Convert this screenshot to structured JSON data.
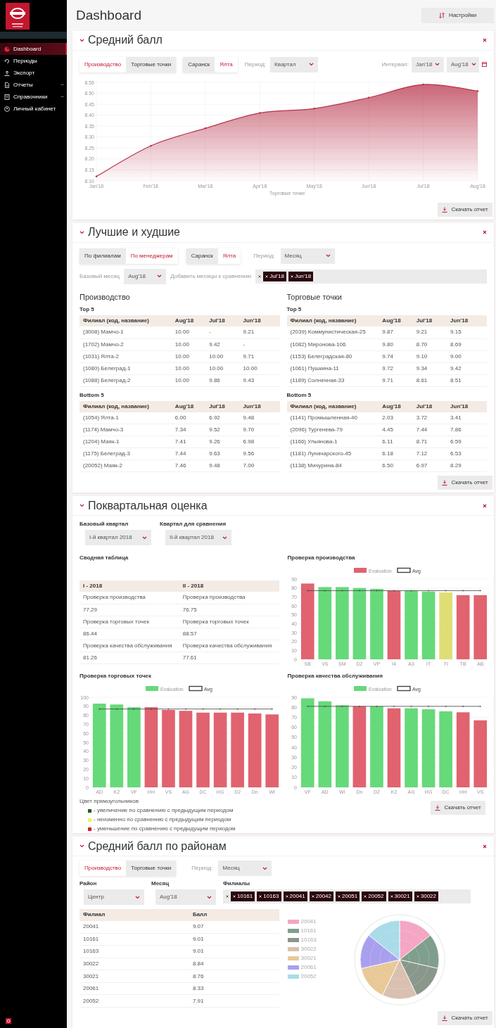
{
  "sidebar": {
    "items": [
      {
        "label": "Dashboard",
        "selected": true,
        "has_submenu": false
      },
      {
        "label": "Периоды",
        "selected": false,
        "has_submenu": false
      },
      {
        "label": "Экспорт",
        "selected": false,
        "has_submenu": false
      },
      {
        "label": "Отчеты",
        "selected": false,
        "has_submenu": true
      },
      {
        "label": "Справочники",
        "selected": false,
        "has_submenu": true
      },
      {
        "label": "Личный кабинет",
        "selected": false,
        "has_submenu": false
      }
    ]
  },
  "page_title": "Dashboard",
  "settings_button": "Настройки",
  "average_score": {
    "title": "Средний балл",
    "toggles": [
      [
        {
          "label": "Производство",
          "selected": true
        },
        {
          "label": "Торговые точки",
          "selected": false
        }
      ],
      [
        {
          "label": "Саранск",
          "selected": false
        },
        {
          "label": "Ялта",
          "selected": true
        }
      ]
    ],
    "period": {
      "label": "Период:",
      "value": "Квартал"
    },
    "interval": {
      "label": "Интервал:",
      "from": "Jan'18",
      "to": "Aug'18"
    },
    "chart_data": {
      "type": "area",
      "xlabel": "Торговые точки",
      "categories": [
        "Jan'18",
        "Feb'18",
        "Mar'18",
        "Apr'18",
        "May'18",
        "Jun'18",
        "Jul'18",
        "Aug'18"
      ],
      "series": [
        {
          "color": "#b8334a",
          "values": [
            8.12,
            8.26,
            8.34,
            8.41,
            8.43,
            8.48,
            8.54,
            8.51
          ]
        }
      ],
      "ylim": [
        8.1,
        8.55
      ],
      "grid": true,
      "yticks": [
        {
          "value": 8.1,
          "label": "8.10"
        },
        {
          "value": 8.15,
          "label": "8.15"
        },
        {
          "value": 8.2,
          "label": "8.20"
        },
        {
          "value": 8.25,
          "label": "8.25"
        },
        {
          "value": 8.3,
          "label": "8.30"
        },
        {
          "value": 8.35,
          "label": "8.35"
        },
        {
          "value": 8.4,
          "label": "8.40"
        },
        {
          "value": 8.45,
          "label": "8.45"
        },
        {
          "value": 8.5,
          "label": "8.50"
        },
        {
          "value": 8.55,
          "label": "8.55"
        }
      ]
    },
    "download_button": "Скачать отчет"
  },
  "best_worst": {
    "title": "Лучшие и худшие",
    "toggles": [
      [
        {
          "label": "По филиалам",
          "selected": false
        },
        {
          "label": "По менеджерам",
          "selected": true
        }
      ],
      [
        {
          "label": "Саранск",
          "selected": false
        },
        {
          "label": "Ялта",
          "selected": true
        }
      ]
    ],
    "period": {
      "label": "Период:",
      "value": "Месяц"
    },
    "base_month": {
      "label": "Базовый месяц",
      "value": "Aug'18"
    },
    "compare": {
      "label": "Добавить месяцы к сравнению",
      "tags": [
        "Jul'18",
        "Jun'18"
      ]
    },
    "groups": [
      {
        "title": "Производство",
        "tables": [
          {
            "title": "Top 5",
            "columns": [
              "Филиал (код, название)",
              "Aug'18",
              "Jul'18",
              "Jun'18"
            ],
            "rows": [
              [
                "(3008) Мамчо-1",
                "10.00",
                "-",
                "9.21"
              ],
              [
                "(1702) Мамчо-2",
                "10.00",
                "9.42",
                "-"
              ],
              [
                "(1031) Ялта-2",
                "10.00",
                "10.00",
                "9.71"
              ],
              [
                "(1080) Белеград-1",
                "10.00",
                "10.00",
                "10.00"
              ],
              [
                "(1088) Белеград-2",
                "10.00",
                "9.86",
                "9.43"
              ]
            ]
          },
          {
            "title": "Bottom 5",
            "columns": [
              "Филиал (код, название)",
              "Aug'18",
              "Jul'18",
              "Jun'18"
            ],
            "rows": [
              [
                "(1054) Ялта-1",
                "6.00",
                "6.92",
                "9.48"
              ],
              [
                "(1174) Мамчо-3",
                "7.34",
                "9.52",
                "9.70"
              ],
              [
                "(1204) Маяк-1",
                "7.41",
                "9.26",
                "6.98"
              ],
              [
                "(1175) Белеград-3",
                "7.44",
                "9.63",
                "9.56"
              ],
              [
                "(20052) Маяк-2",
                "7.46",
                "9.48",
                "7.00"
              ]
            ]
          }
        ]
      },
      {
        "title": "Торговые точки",
        "tables": [
          {
            "title": "Top 5",
            "columns": [
              "Филиал (код, название)",
              "Aug'18",
              "Jul'18",
              "Jun'18"
            ],
            "rows": [
              [
                "(2039) Коммунистическая-25",
                "9.87",
                "9.21",
                "9.15"
              ],
              [
                "(1082) Миронова-106",
                "9.80",
                "8.70",
                "8.69"
              ],
              [
                "(1153) Белеградская-80",
                "9.74",
                "9.10",
                "9.00"
              ],
              [
                "(1061) Пушкина-11",
                "9.72",
                "9.34",
                "9.42"
              ],
              [
                "(1189) Солнечная-33",
                "9.71",
                "8.61",
                "8.51"
              ]
            ]
          },
          {
            "title": "Bottom 5",
            "columns": [
              "Филиал (код, название)",
              "Aug'18",
              "Jul'18",
              "Jun'18"
            ],
            "rows": [
              [
                "(1141) Промышленная-40",
                "2.03",
                "3.72",
                "3.41"
              ],
              [
                "(2096) Тургенева-79",
                "4.45",
                "7.44",
                "7.86"
              ],
              [
                "(1166) Ульянова-1",
                "6.11",
                "8.71",
                "6.59"
              ],
              [
                "(1181) Луначарского-45",
                "6.18",
                "7.12",
                "6.53"
              ],
              [
                "(1138) Мичурина-84",
                "6.50",
                "6.97",
                "8.29"
              ]
            ]
          }
        ]
      }
    ],
    "download_button": "Скачать отчет"
  },
  "quarterly": {
    "title": "Поквартальная оценка",
    "base_quarter": {
      "label": "Базовый квартал",
      "value": "I-й квартал 2018"
    },
    "compare_quarter": {
      "label": "Квартал для сравнения",
      "value": "II-й квартал 2018"
    },
    "summary": {
      "title": "Сводная таблица",
      "columns": [
        "I - 2018",
        "II - 2018"
      ],
      "rows": [
        [
          "Проверка производства",
          "Проверка производства"
        ],
        [
          "77.29",
          "76.75"
        ],
        [
          "Проверка торговых точек",
          "Проверка торговых точек"
        ],
        [
          "86.44",
          "88.57"
        ],
        [
          "Проверка качества обслуживания",
          "Проверка качества обслуживания"
        ],
        [
          "81.26",
          "77.61"
        ]
      ]
    },
    "charts": [
      {
        "title": "Проверка производства",
        "chart_data": {
          "type": "bar",
          "categories": [
            "SB",
            "VS",
            "SM",
            "D2",
            "VP",
            "I4",
            "A3",
            "IT",
            "TI",
            "TB",
            "AB"
          ],
          "series": [
            {
              "name": "Evaluation",
              "type": "bar",
              "values": [
                85,
                81,
                81,
                80,
                79,
                77,
                77,
                76,
                75,
                72,
                72
              ],
              "colors": [
                "#e0636f",
                "#66d97a",
                "#66d97a",
                "#66d97a",
                "#66d97a",
                "#e0636f",
                "#66d97a",
                "#66d97a",
                "#dede74",
                "#e0636f",
                "#e0636f"
              ]
            },
            {
              "name": "Avg",
              "type": "line",
              "color": "#444444",
              "values": [
                77,
                77,
                77,
                77,
                77,
                77,
                77,
                77,
                77,
                77,
                77
              ]
            }
          ],
          "grid": true,
          "legend": "top",
          "ylim": [
            0,
            90
          ],
          "yticks": [
            0,
            10,
            20,
            30,
            40,
            50,
            60,
            70,
            80,
            90
          ]
        }
      },
      {
        "title": "Проверка торговых точек",
        "chart_data": {
          "type": "bar",
          "categories": [
            "AD",
            "K2",
            "VF",
            "HH",
            "VS",
            "AG",
            "DC",
            "HG",
            "D2",
            "Dn",
            "WI"
          ],
          "series": [
            {
              "name": "Evaluation",
              "type": "bar",
              "values": [
                93,
                92,
                89,
                89,
                86,
                85,
                83,
                83,
                83,
                82,
                81
              ],
              "colors": [
                "#66d97a",
                "#66d97a",
                "#66d97a",
                "#e0636f",
                "#e0636f",
                "#e0636f",
                "#e0636f",
                "#e0636f",
                "#e0636f",
                "#e0636f",
                "#e0636f"
              ]
            },
            {
              "name": "Avg",
              "type": "line",
              "color": "#444444",
              "values": [
                87,
                87,
                87,
                87,
                87,
                87,
                87,
                87,
                87,
                87,
                87
              ]
            }
          ],
          "grid": true,
          "legend": "top",
          "ylim": [
            0,
            100
          ],
          "yticks": [
            0,
            10,
            20,
            30,
            40,
            50,
            60,
            70,
            80,
            90,
            100
          ]
        }
      },
      {
        "title": "Проверка качества обслуживания",
        "chart_data": {
          "type": "bar",
          "categories": [
            "VF",
            "AD",
            "WI",
            "Dn",
            "D2",
            "K2",
            "AG",
            "HG",
            "DC",
            "HH",
            "VS"
          ],
          "series": [
            {
              "name": "Evaluation",
              "type": "bar",
              "values": [
                89,
                86,
                82,
                81,
                81,
                79,
                79,
                78,
                76,
                75,
                67
              ],
              "colors": [
                "#66d97a",
                "#66d97a",
                "#66d97a",
                "#e0636f",
                "#66d97a",
                "#e0636f",
                "#66d97a",
                "#66d97a",
                "#66d97a",
                "#e0636f",
                "#e0636f"
              ]
            },
            {
              "name": "Avg",
              "type": "line",
              "color": "#444444",
              "values": [
                81,
                81,
                81,
                81,
                81,
                81,
                81,
                81,
                81,
                81,
                81
              ]
            }
          ],
          "grid": true,
          "legend": "top",
          "ylim": [
            0,
            90
          ],
          "yticks": [
            0,
            10,
            20,
            30,
            40,
            50,
            60,
            70,
            80,
            90
          ]
        }
      }
    ],
    "color_legend": {
      "title": "Цвет прямоугольников",
      "items": [
        {
          "label": "- увеличение по сравнению с предыдущим периодом",
          "color": "#1f5f0f"
        },
        {
          "label": "- неизменно по сравнению с предыдущим периодом",
          "color": "#f0f05a"
        },
        {
          "label": "- уменьшение по сравнению с предыдущим периодом",
          "color": "#d21e2e"
        }
      ]
    },
    "download_button": "Скачать отчет"
  },
  "district_score": {
    "title": "Средний балл по районам",
    "toggles": [
      [
        {
          "label": "Производство",
          "selected": true
        },
        {
          "label": "Торговые точки",
          "selected": false
        }
      ]
    ],
    "period": {
      "label": "Период:",
      "value": "Месяц"
    },
    "district": {
      "label": "Район",
      "value": "Центр"
    },
    "month": {
      "label": "Месяц",
      "value": "Aug'18"
    },
    "branches": {
      "label": "Филиалы",
      "tags": [
        "10161",
        "10163",
        "20041",
        "20042",
        "20051",
        "20052",
        "30021",
        "30022"
      ]
    },
    "table": {
      "columns": [
        "Филиал",
        "Балл"
      ],
      "rows": [
        [
          "20041",
          "9.07"
        ],
        [
          "10161",
          "9.01"
        ],
        [
          "10163",
          "9.01"
        ],
        [
          "30022",
          "8.84"
        ],
        [
          "30021",
          "8.76"
        ],
        [
          "20061",
          "8.33"
        ],
        [
          "20052",
          "7.91"
        ]
      ]
    },
    "polar_legend": [
      {
        "label": "20041",
        "color": "#f4a6c4"
      },
      {
        "label": "10161",
        "color": "#7f9f8c"
      },
      {
        "label": "10163",
        "color": "#8a978b"
      },
      {
        "label": "30022",
        "color": "#d9c0b0"
      },
      {
        "label": "30021",
        "color": "#e8c997"
      },
      {
        "label": "20061",
        "color": "#a8a0ee"
      },
      {
        "label": "20052",
        "color": "#a9dbe8"
      }
    ],
    "download_button": "Скачать отчет"
  }
}
